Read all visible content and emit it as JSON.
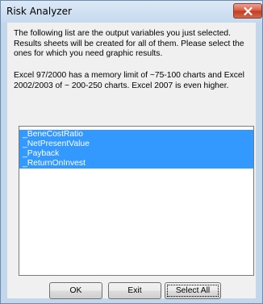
{
  "window": {
    "title": "Risk Analyzer"
  },
  "description": "The following list are the output variables you just selected. Results sheets will be created for all of them.  Please select the ones for which you need graphic results.",
  "memory_note": "Excel 97/2000 has a memory limit of ~75-100 charts and Excel 2002/2003 of ~ 200-250 charts. Excel 2007 is even higher.",
  "list": {
    "items": [
      {
        "label": "_BeneCostRatio",
        "selected": true
      },
      {
        "label": "_NetPresentValue",
        "selected": true
      },
      {
        "label": "_Payback",
        "selected": true
      },
      {
        "label": "_ReturnOnInvest",
        "selected": true
      }
    ]
  },
  "buttons": {
    "ok": "OK",
    "exit": "Exit",
    "select_all": "Select All"
  },
  "colors": {
    "selection": "#3399ff",
    "close_button": "#c43a1f",
    "dialog_face": "#f0f0f0",
    "frame": "#c3d7ec"
  },
  "icons": {
    "close": "close-icon"
  }
}
